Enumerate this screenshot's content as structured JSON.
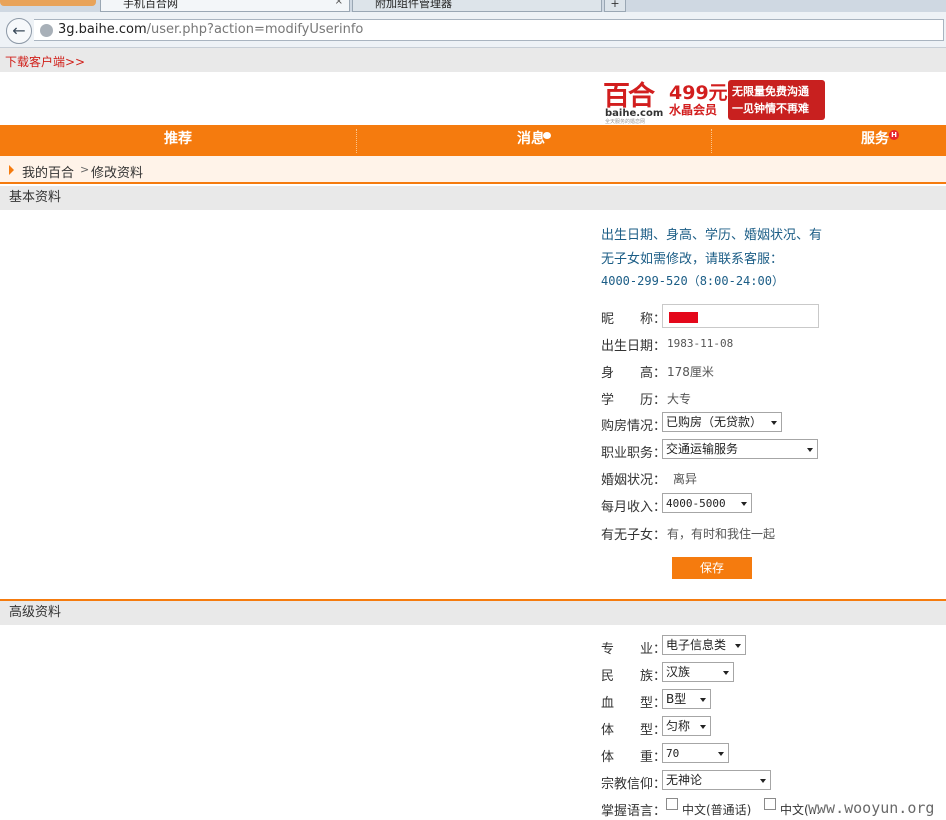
{
  "browser": {
    "tabs": [
      {
        "label": "手机百合网"
      },
      {
        "label": "附加组件管理器"
      }
    ],
    "new_tab_label": "+",
    "url": {
      "host": "3g.baihe.com",
      "path": "/user.php?action=modifyUserinfo"
    }
  },
  "top_bar": {
    "download_link": "下载客户端>>"
  },
  "banner": {
    "logo_text": "百合",
    "logo_domain": "baihe.com",
    "logo_tagline": "全天服务的婚恋网",
    "price": "499元",
    "price_sub": "水晶会员",
    "promo_line1": "无限量免费沟通",
    "promo_line2": "一见钟情不再难"
  },
  "nav": {
    "items": [
      {
        "label": "推荐"
      },
      {
        "label": "消息"
      },
      {
        "label": "服务"
      }
    ],
    "badge_h": "H"
  },
  "breadcrumb": {
    "home": "我的百合",
    "current": "修改资料"
  },
  "basic": {
    "section_title": "基本资料",
    "notice": "出生日期、身高、学历、婚姻状况、有无子女如需修改，请联系客服：",
    "phone": "4000-299-520（8:00-24:00）",
    "fields": {
      "nickname_label": "昵　　称：",
      "birthday_label": "出生日期：",
      "birthday_value": "1983-11-08",
      "height_label": "身　　高：",
      "height_value": "178厘米",
      "education_label": "学　　历：",
      "education_value": "大专",
      "house_label": "购房情况：",
      "house_value": "已购房（无贷款）",
      "job_label": "职业职务：",
      "job_value": "交通运输服务",
      "marital_label": "婚姻状况：",
      "marital_value": "离异",
      "income_label": "每月收入：",
      "income_value": "4000-5000",
      "children_label": "有无子女：",
      "children_value": "有，有时和我住一起"
    },
    "save_label": "保存"
  },
  "advanced": {
    "section_title": "高级资料",
    "fields": {
      "major_label": "专　　业：",
      "major_value": "电子信息类",
      "ethnicity_label": "民　　族：",
      "ethnicity_value": "汉族",
      "blood_label": "血　　型：",
      "blood_value": "B型",
      "body_label": "体　　型：",
      "body_value": "匀称",
      "weight_label": "体　　重：",
      "weight_value": "70",
      "religion_label": "宗教信仰：",
      "religion_value": "无神论",
      "language_label": "掌握语言：",
      "language_opt1": "中文(普通话)",
      "language_opt2": "中文(..."
    }
  },
  "watermark": "www.wooyun.org",
  "colors": {
    "brand_orange": "#f57b0e",
    "notice_blue": "#1b5d86",
    "alert_red": "#d0201a"
  }
}
